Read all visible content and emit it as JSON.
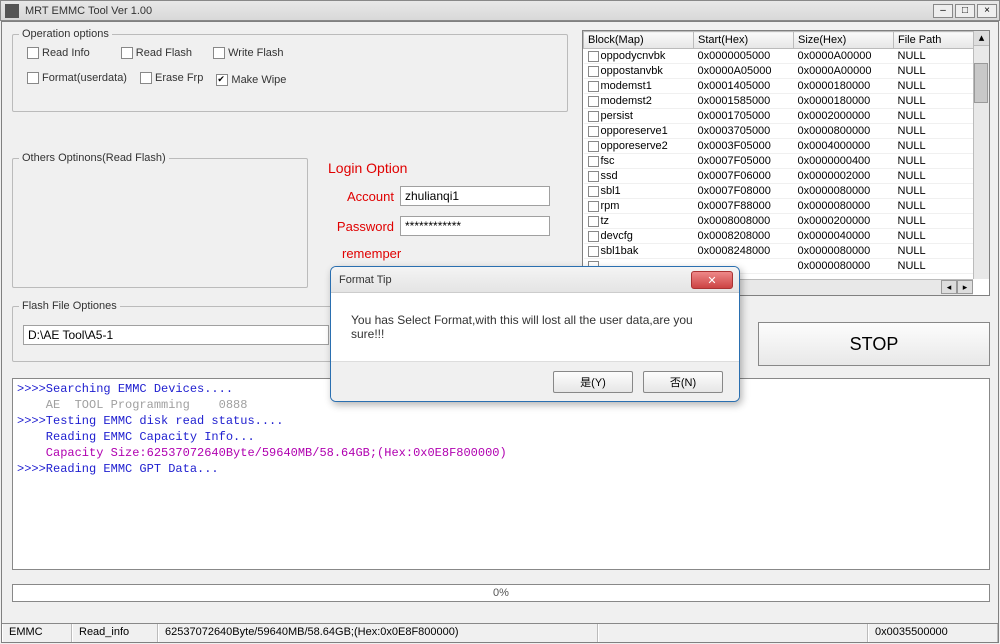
{
  "window": {
    "title": "MRT EMMC Tool Ver 1.00"
  },
  "operation_options": {
    "legend": "Operation options",
    "items": [
      {
        "label": "Read Info",
        "checked": false
      },
      {
        "label": "Read Flash",
        "checked": false
      },
      {
        "label": "Write Flash",
        "checked": false
      },
      {
        "label": "Format(userdata)",
        "checked": false
      },
      {
        "label": "Erase Frp",
        "checked": false
      },
      {
        "label": "Make Wipe",
        "checked": true
      }
    ]
  },
  "others_options": {
    "legend": "Others Optinons(Read Flash)"
  },
  "login": {
    "heading": "Login Option",
    "account_label": "Account",
    "password_label": "Password",
    "remember_label": "rememper",
    "account_value": "zhulianqi1",
    "password_value": "************"
  },
  "flash_file": {
    "legend": "Flash File Optiones",
    "value": "D:\\AE Tool\\A5-1"
  },
  "partition_table": {
    "columns": [
      "Block(Map)",
      "Start(Hex)",
      "Size(Hex)",
      "File Path"
    ],
    "rows": [
      {
        "block": "oppodycnvbk",
        "start": "0x0000005000",
        "size": "0x0000A00000",
        "file": "NULL"
      },
      {
        "block": "oppostanvbk",
        "start": "0x0000A05000",
        "size": "0x0000A00000",
        "file": "NULL"
      },
      {
        "block": "modemst1",
        "start": "0x0001405000",
        "size": "0x0000180000",
        "file": "NULL"
      },
      {
        "block": "modemst2",
        "start": "0x0001585000",
        "size": "0x0000180000",
        "file": "NULL"
      },
      {
        "block": "persist",
        "start": "0x0001705000",
        "size": "0x0002000000",
        "file": "NULL"
      },
      {
        "block": "opporeserve1",
        "start": "0x0003705000",
        "size": "0x0000800000",
        "file": "NULL"
      },
      {
        "block": "opporeserve2",
        "start": "0x0003F05000",
        "size": "0x0004000000",
        "file": "NULL"
      },
      {
        "block": "fsc",
        "start": "0x0007F05000",
        "size": "0x0000000400",
        "file": "NULL"
      },
      {
        "block": "ssd",
        "start": "0x0007F06000",
        "size": "0x0000002000",
        "file": "NULL"
      },
      {
        "block": "sbl1",
        "start": "0x0007F08000",
        "size": "0x0000080000",
        "file": "NULL"
      },
      {
        "block": "rpm",
        "start": "0x0007F88000",
        "size": "0x0000080000",
        "file": "NULL"
      },
      {
        "block": "tz",
        "start": "0x0008008000",
        "size": "0x0000200000",
        "file": "NULL"
      },
      {
        "block": "devcfg",
        "start": "0x0008208000",
        "size": "0x0000040000",
        "file": "NULL"
      },
      {
        "block": "sbl1bak",
        "start": "0x0008248000",
        "size": "0x0000080000",
        "file": "NULL"
      },
      {
        "block": "",
        "start": "",
        "size": "0x0000080000",
        "file": "NULL"
      }
    ]
  },
  "buttons": {
    "stop": "STOP"
  },
  "log": {
    "lines": [
      {
        "cls": "c-blue",
        "text": ">>>>Searching EMMC Devices...."
      },
      {
        "cls": "c-gray",
        "text": "    AE  TOOL Programming    0888"
      },
      {
        "cls": "c-blue",
        "text": ">>>>Testing EMMC disk read status...."
      },
      {
        "cls": "c-blue",
        "text": "    Reading EMMC Capacity Info..."
      },
      {
        "cls": "c-purple",
        "text": "    Capacity Size:62537072640Byte/59640MB/58.64GB;(Hex:0x0E8F800000)"
      },
      {
        "cls": "c-blue",
        "text": ">>>>Reading EMMC GPT Data..."
      }
    ]
  },
  "progress": {
    "text": "0%"
  },
  "status_bar": {
    "cells": [
      "EMMC",
      "Read_info",
      "62537072640Byte/59640MB/58.64GB;(Hex:0x0E8F800000)",
      "",
      "0x0035500000"
    ]
  },
  "dialog": {
    "title": "Format Tip",
    "message": "You has Select Format,with this will lost all the user data,are you sure!!!",
    "yes": "是(Y)",
    "no": "否(N)"
  }
}
